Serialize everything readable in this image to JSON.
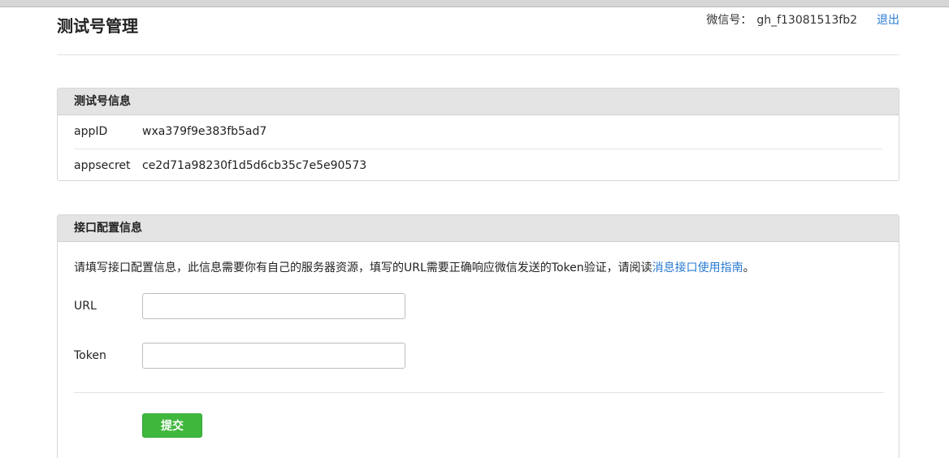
{
  "header": {
    "title": "测试号管理",
    "wechat_label": "微信号：",
    "wechat_id": "gh_f13081513fb2",
    "logout_label": "退出"
  },
  "test_account": {
    "title": "测试号信息",
    "rows": [
      {
        "key": "appID",
        "value": "wxa379f9e383fb5ad7"
      },
      {
        "key": "appsecret",
        "value": "ce2d71a98230f1d5d6cb35c7e5e90573"
      }
    ]
  },
  "interface_config": {
    "title": "接口配置信息",
    "description": "请填写接口配置信息，此信息需要你有自己的服务器资源，填写的URL需要正确响应微信发送的Token验证，请阅读",
    "guide_link": "消息接口使用指南",
    "description_end": "。",
    "fields": [
      {
        "label": "URL",
        "value": "",
        "placeholder": ""
      },
      {
        "label": "Token",
        "value": "",
        "placeholder": ""
      }
    ],
    "submit_label": "提交"
  },
  "colors": {
    "link": "#2a7bd3",
    "submit_button": "#3fb73d",
    "panel_header": "#e4e4e4"
  }
}
